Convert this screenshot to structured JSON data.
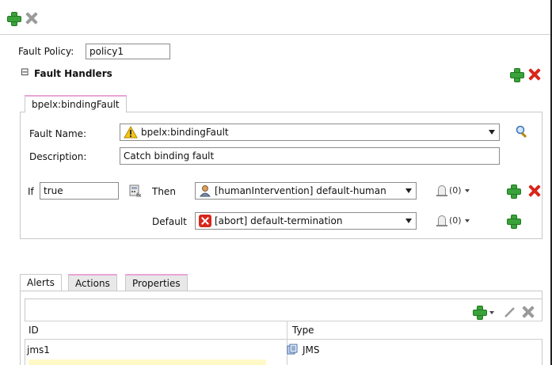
{
  "toolbar": {
    "add_icon": "plus-green-icon",
    "remove_icon": "x-gray-icon"
  },
  "fault_policy": {
    "label": "Fault Policy:",
    "value": "policy1"
  },
  "fault_handlers": {
    "toggle_symbol": "⊟",
    "title": "Fault Handlers",
    "tab_label": "bpelx:bindingFault",
    "fault_name_label": "Fault Name:",
    "fault_name_value": "bpelx:bindingFault",
    "description_label": "Description:",
    "description_value": "Catch binding fault",
    "if_label": "If",
    "if_value": "true",
    "then_label": "Then",
    "then_value": "[humanIntervention] default-human",
    "then_count": "(0)",
    "default_label": "Default",
    "default_value": "[abort] default-termination",
    "default_count": "(0)"
  },
  "bottom_tabs": [
    "Alerts",
    "Actions",
    "Properties"
  ],
  "alerts_table": {
    "columns": [
      "ID",
      "Type"
    ],
    "rows": [
      {
        "id": "jms1",
        "type": "JMS"
      }
    ]
  },
  "colors": {
    "green": "#3aa23a",
    "red": "#d8261c",
    "gray": "#9a9a9a",
    "tab_accent": "#e9a4d6"
  }
}
